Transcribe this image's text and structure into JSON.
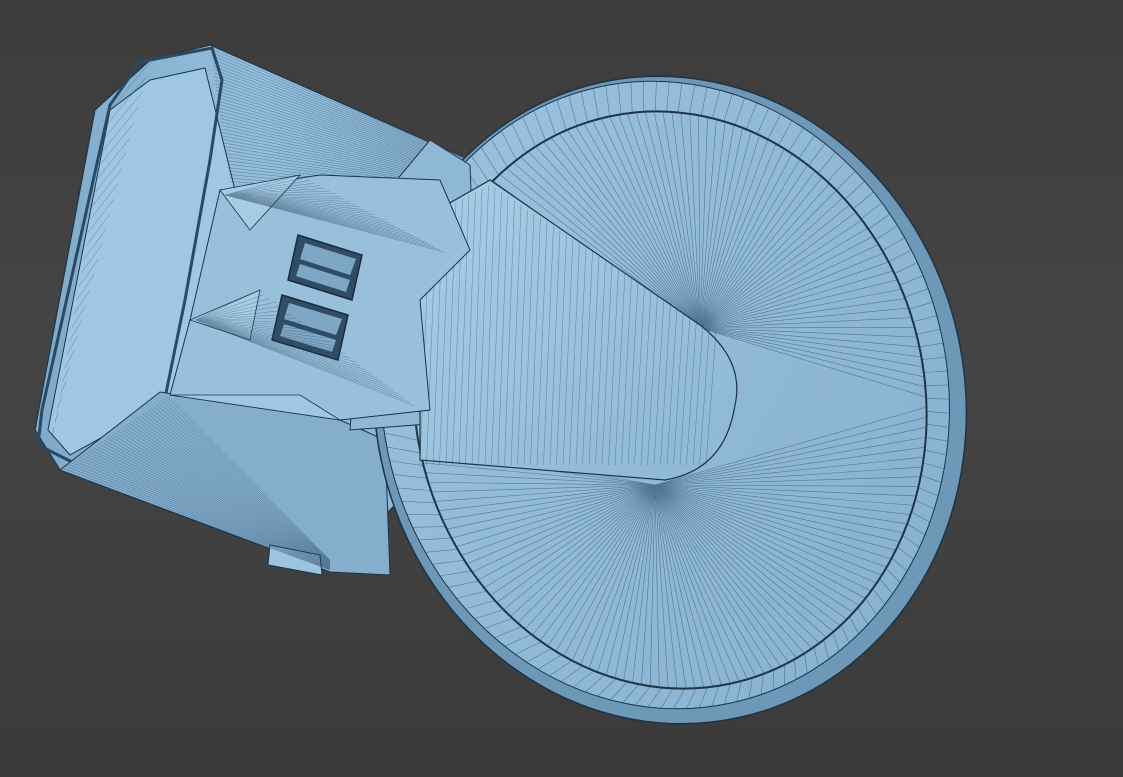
{
  "viewport": {
    "background_color": "#404040",
    "model_color": "#8fb8d6",
    "edge_color": "#1e3447",
    "render_mode": "wireframe-on-shaded"
  },
  "model": {
    "parts": [
      "disc-base",
      "raised-paddle",
      "rectangular-connector-housing",
      "latch-window",
      "latch-window",
      "side-tab"
    ]
  }
}
